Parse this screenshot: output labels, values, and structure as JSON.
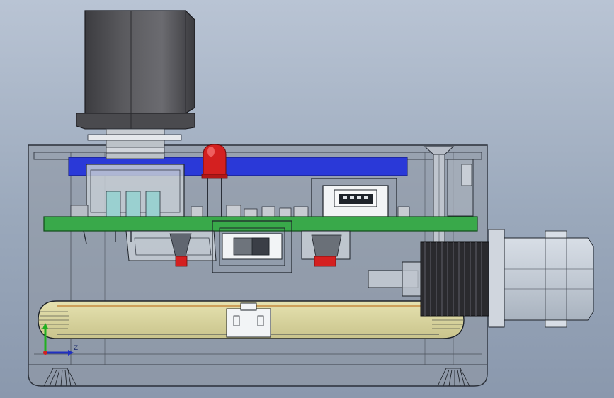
{
  "viewport": {
    "background_top": "#b9c4d4",
    "background_bottom": "#8a98ad"
  },
  "model": {
    "enclosure_color": "#8f97a3",
    "pcb_color": "#39a94a",
    "blue_board_color": "#2a39d8",
    "led_color": "#d42020",
    "bnc_color": "#c4ccd6",
    "knob_color": "#4e4e52"
  },
  "triad": {
    "axis_x_color": "#2030c0",
    "axis_y_color": "#20b020",
    "axis_z_color": "#d02020",
    "label": "Z"
  }
}
